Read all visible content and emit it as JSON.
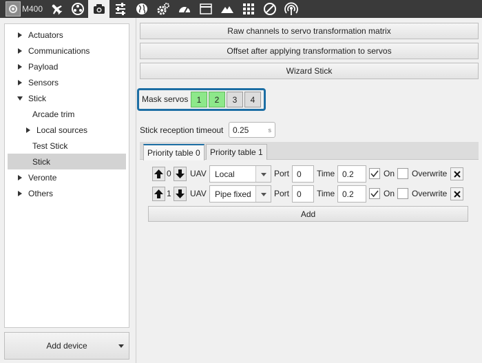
{
  "toolbar": {
    "device_name": "M400",
    "icons": [
      "airplane-icon",
      "joystick-icon",
      "camera-icon",
      "sliders-icon",
      "globe-icon",
      "gears-icon",
      "gauge-icon",
      "window-icon",
      "terrain-icon",
      "grid-icon",
      "prohibited-icon",
      "signal-icon"
    ],
    "active_icon": "camera-icon"
  },
  "sidebar": {
    "items": [
      {
        "label": "Actuators",
        "expander": "collapsed"
      },
      {
        "label": "Communications",
        "expander": "collapsed"
      },
      {
        "label": "Payload",
        "expander": "collapsed"
      },
      {
        "label": "Sensors",
        "expander": "collapsed"
      },
      {
        "label": "Stick",
        "expander": "expanded"
      },
      {
        "label": "Arcade trim",
        "expander": "none"
      },
      {
        "label": "Local sources",
        "expander": "collapsed"
      },
      {
        "label": "Test Stick",
        "expander": "none"
      },
      {
        "label": "Stick",
        "expander": "none",
        "selected": true
      },
      {
        "label": "Veronte",
        "expander": "collapsed"
      },
      {
        "label": "Others",
        "expander": "collapsed"
      }
    ],
    "add_device_label": "Add device"
  },
  "main": {
    "buttons": {
      "raw_channels": "Raw channels to servo transformation matrix",
      "offset": "Offset after applying transformation to servos",
      "wizard": "Wizard Stick"
    },
    "mask": {
      "label": "Mask servos",
      "servos": [
        {
          "label": "1",
          "on": true
        },
        {
          "label": "2",
          "on": true
        },
        {
          "label": "3",
          "on": false
        },
        {
          "label": "4",
          "on": false
        }
      ]
    },
    "timeout": {
      "label": "Stick reception timeout",
      "value": "0.25",
      "unit": "s"
    },
    "tabs": [
      {
        "label": "Priority table 0",
        "active": true
      },
      {
        "label": "Priority table 1",
        "active": false
      }
    ],
    "row_labels": {
      "uav": "UAV",
      "port": "Port",
      "time": "Time",
      "on": "On",
      "overwrite": "Overwrite"
    },
    "rows": [
      {
        "index": "0",
        "uav": "Local",
        "port": "0",
        "time": "0.2",
        "on": true,
        "overwrite": false
      },
      {
        "index": "1",
        "uav": "Pipe fixed",
        "port": "0",
        "time": "0.2",
        "on": true,
        "overwrite": false
      }
    ],
    "add_label": "Add"
  },
  "colors": {
    "toolbar_bg": "#3a3a3a",
    "accent": "#1c6ea4",
    "mask_on": "#8de88a",
    "mask_off": "#dcdcdc",
    "selected_row": "#d3d3d3"
  }
}
